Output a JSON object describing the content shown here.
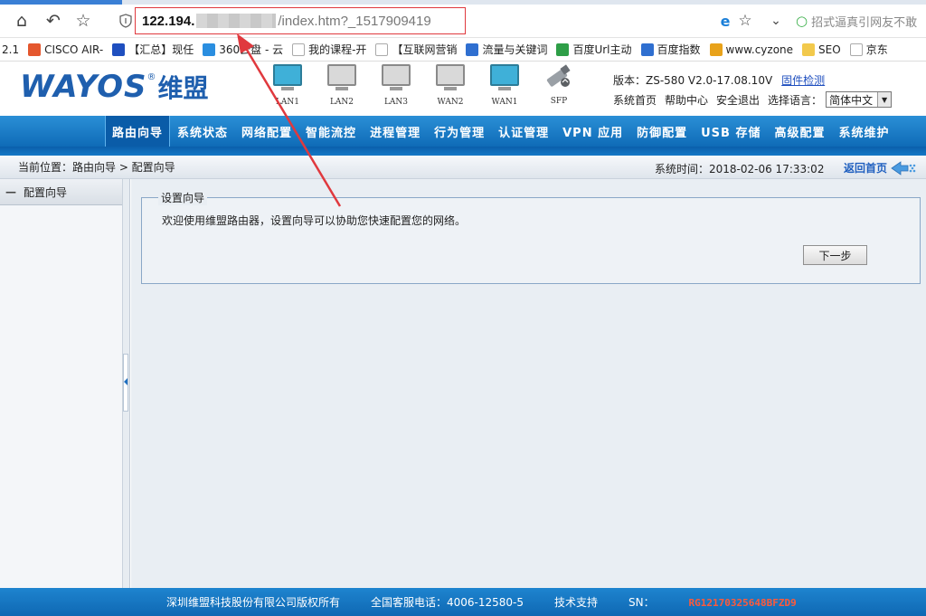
{
  "browser": {
    "url_host": "122.194.",
    "url_path": "/index.htm?_1517909419",
    "search_placeholder": "招式逼真引网友不敢",
    "bookmarks": [
      {
        "label": "2.1",
        "icon": "none",
        "color": ""
      },
      {
        "label": "CISCO AIR-",
        "icon": "bookmark-icon",
        "color": "#e4572e"
      },
      {
        "label": "【汇总】现任",
        "icon": "bookmark-icon",
        "color": "#1f4fbf"
      },
      {
        "label": "360云盘 - 云",
        "icon": "cloud-icon",
        "color": "#2a8ee0"
      },
      {
        "label": "我的课程-开",
        "icon": "page-icon",
        "color": "#aaaaaa"
      },
      {
        "label": "【互联网营销",
        "icon": "page-icon",
        "color": "#aaaaaa"
      },
      {
        "label": "流量与关键词",
        "icon": "paw-icon",
        "color": "#2f6fd0"
      },
      {
        "label": "百度Url主动",
        "icon": "bookmark-icon",
        "color": "#2e9e47"
      },
      {
        "label": "百度指数",
        "icon": "paw-icon",
        "color": "#2f6fd0"
      },
      {
        "label": "www.cyzone",
        "icon": "bookmark-icon",
        "color": "#e8a21a"
      },
      {
        "label": "SEO",
        "icon": "folder-icon",
        "color": "#f2c94c"
      },
      {
        "label": "京东",
        "icon": "page-icon",
        "color": "#aaaaaa"
      }
    ]
  },
  "header": {
    "logo_text": "WAYOS",
    "logo_reg": "®",
    "logo_cn": "维盟",
    "ports": [
      {
        "label": "LAN1",
        "active": true
      },
      {
        "label": "LAN2",
        "active": false
      },
      {
        "label": "LAN3",
        "active": false
      },
      {
        "label": "WAN2",
        "active": false
      },
      {
        "label": "WAN1",
        "active": true
      },
      {
        "label": "SFP",
        "active": false
      }
    ],
    "version": "版本：ZS-580 V2.0-17.08.10V",
    "firmware_link": "固件检测",
    "links": [
      "系统首页",
      "帮助中心",
      "安全退出"
    ],
    "lang_label": "选择语言：",
    "lang_value": "简体中文"
  },
  "menu": {
    "items": [
      "路由向导",
      "系统状态",
      "网络配置",
      "智能流控",
      "进程管理",
      "行为管理",
      "认证管理",
      "VPN 应用",
      "防御配置",
      "USB 存储",
      "高级配置",
      "系统维护"
    ],
    "active_index": 0
  },
  "crumb": {
    "text": "当前位置：路由向导 > 配置向导",
    "systime": "系统时间：2018-02-06 17:33:02",
    "back_home": "返回首页"
  },
  "sidebar": {
    "item": "配置向导"
  },
  "wizard": {
    "legend": "设置向导",
    "text": "欢迎使用维盟路由器，设置向导可以协助您快速配置您的网络。",
    "next_label": "下一步"
  },
  "footer": {
    "copyright": "深圳维盟科技股份有限公司版权所有",
    "hotline": "全国客服电话：4006-12580-5",
    "support": "技术支持",
    "sn_label": "SN：",
    "sn_value": "RG12170325648BFZD9"
  },
  "colors": {
    "menu_blue": "#1478c6",
    "annotation_red": "#e0393e",
    "sn_red": "#ff5a3a"
  }
}
